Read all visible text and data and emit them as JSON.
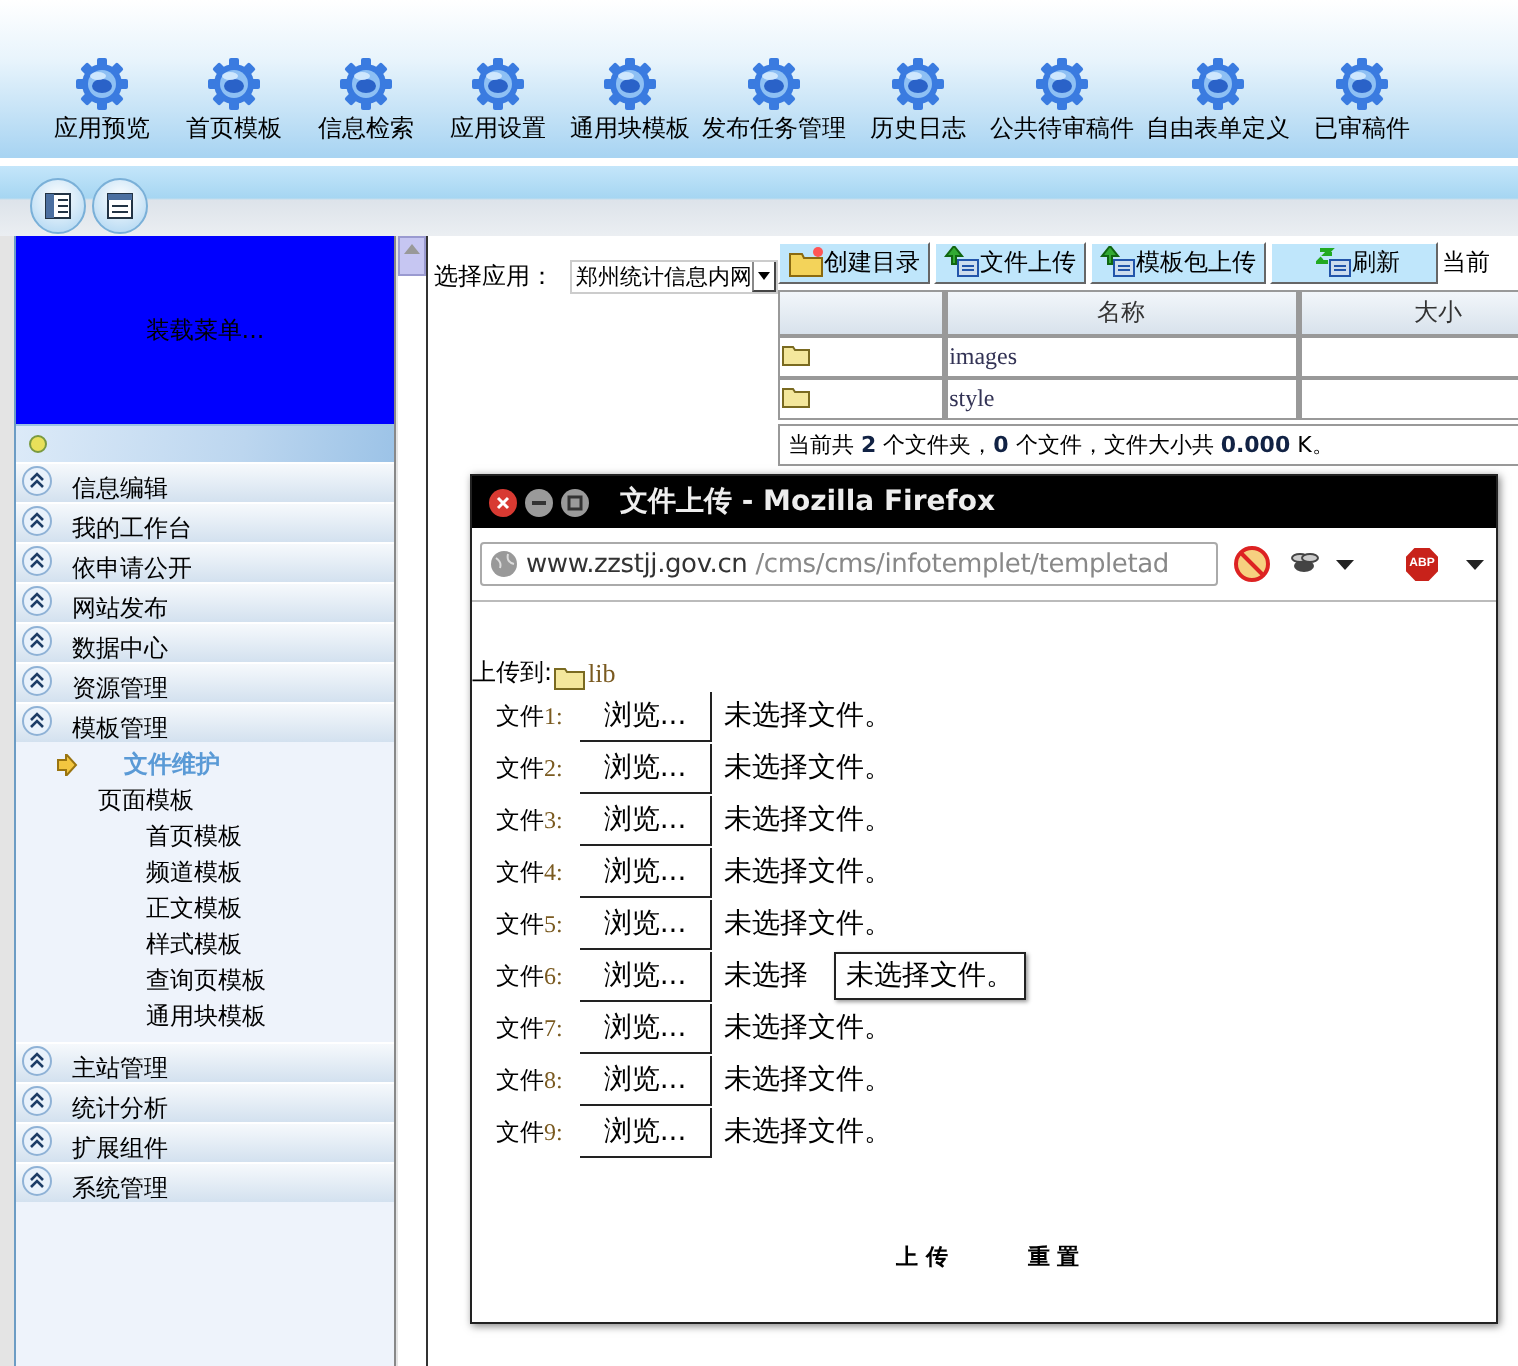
{
  "header": {
    "toolbar": [
      {
        "label": "应用预览"
      },
      {
        "label": "首页模板"
      },
      {
        "label": "信息检索"
      },
      {
        "label": "应用设置"
      },
      {
        "label": "通用块模板"
      },
      {
        "label": "发布任务管理"
      },
      {
        "label": "历史日志"
      },
      {
        "label": "公共待审稿件"
      },
      {
        "label": "自由表单定义"
      },
      {
        "label": "已审稿件"
      }
    ]
  },
  "sidebar": {
    "loading_text": "装载菜单...",
    "sections": [
      {
        "label": "信息编辑"
      },
      {
        "label": "我的工作台"
      },
      {
        "label": "依申请公开"
      },
      {
        "label": "网站发布"
      },
      {
        "label": "数据中心"
      },
      {
        "label": "资源管理"
      },
      {
        "label": "模板管理",
        "children": [
          {
            "label": "文件维护",
            "selected": true
          },
          {
            "label": "页面模板",
            "selected": false,
            "children": [
              {
                "label": "首页模板",
                "selected": false
              },
              {
                "label": "频道模板",
                "selected": false
              },
              {
                "label": "正文模板",
                "selected": false
              },
              {
                "label": "样式模板",
                "selected": false
              },
              {
                "label": "查询页模板",
                "selected": false
              },
              {
                "label": "通用块模板",
                "selected": false
              }
            ]
          }
        ]
      },
      {
        "label": "主站管理"
      },
      {
        "label": "统计分析"
      },
      {
        "label": "扩展组件"
      },
      {
        "label": "系统管理"
      }
    ]
  },
  "app_selector": {
    "label": "选择应用：",
    "value": "郑州统计信息内网"
  },
  "file_toolbar": [
    {
      "kind": "new-folder",
      "label": "创建目录"
    },
    {
      "kind": "upload",
      "label": "文件上传"
    },
    {
      "kind": "upload",
      "label": "模板包上传"
    },
    {
      "kind": "refresh",
      "label": "刷新"
    }
  ],
  "file_toolbar_overflow": "当前",
  "file_table": {
    "columns": [
      {
        "label": "名称"
      },
      {
        "label": "大小"
      }
    ],
    "rows": [
      {
        "kind": "folder",
        "name": "images"
      },
      {
        "kind": "folder",
        "name": "style"
      }
    ]
  },
  "file_status": "当前共 **2** 个文件夹，**0** 个文件，文件大小共 **0.000** K。",
  "popup": {
    "title": "文件上传 - Mozilla Firefox",
    "url_host": "www.zzstjj.gov.cn",
    "url_path": "/cms/cms/infotemplet/templetad",
    "addon_badge": "ABP",
    "upload_to_label": "上传到:",
    "upload_to_folder": "lib",
    "file_rows": [
      {
        "label": "文件",
        "number": "1:",
        "button": "浏览...",
        "status": "未选择文件。"
      },
      {
        "label": "文件",
        "number": "2:",
        "button": "浏览...",
        "status": "未选择文件。"
      },
      {
        "label": "文件",
        "number": "3:",
        "button": "浏览...",
        "status": "未选择文件。"
      },
      {
        "label": "文件",
        "number": "4:",
        "button": "浏览...",
        "status": "未选择文件。"
      },
      {
        "label": "文件",
        "number": "5:",
        "button": "浏览...",
        "status": "未选择文件。"
      },
      {
        "label": "文件",
        "number": "6:",
        "button": "浏览...",
        "status": "未选择",
        "tooltip": "未选择文件。"
      },
      {
        "label": "文件",
        "number": "7:",
        "button": "浏览...",
        "status": "未选择文件。"
      },
      {
        "label": "文件",
        "number": "8:",
        "button": "浏览...",
        "status": "未选择文件。"
      },
      {
        "label": "文件",
        "number": "9:",
        "button": "浏览...",
        "status": "未选择文件。"
      }
    ],
    "actions": [
      {
        "label": "上 传"
      },
      {
        "label": "重 置"
      }
    ]
  }
}
